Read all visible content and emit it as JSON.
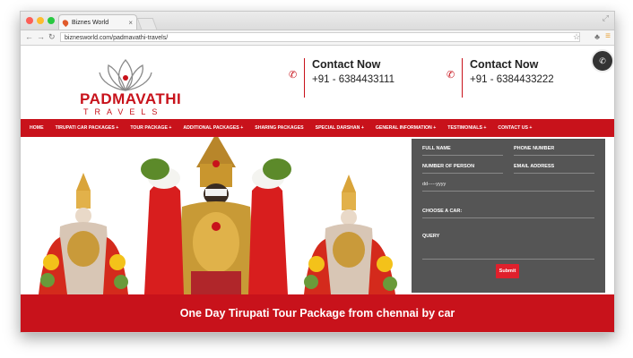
{
  "browser": {
    "tab_title": "Biznes World",
    "url": "biznesworld.com/padmavathi-travels/"
  },
  "logo": {
    "name": "PADMAVATHI",
    "sub": "TRAVELS"
  },
  "contacts": [
    {
      "title": "Contact Now",
      "number": "+91 - 6384433111"
    },
    {
      "title": "Contact Now",
      "number": "+91 - 6384433222"
    }
  ],
  "nav": [
    "HOME",
    "TIRUPATI CAR PACKAGES +",
    "TOUR PACKAGE +",
    "ADDITIONAL PACKAGES +",
    "SHARING PACKAGES",
    "SPECIAL DARSHAN +",
    "GENERAL INFORMATION +",
    "TESTIMONIALS +",
    "CONTACT US +"
  ],
  "form": {
    "full_name": "FULL NAME",
    "phone_number": "PHONE NUMBER",
    "number_of_person": "NUMBER OF PERSON",
    "email_address": "EMAIL ADDRESS",
    "date_placeholder": "dd-----yyyy",
    "choose_car": "CHOOSE A CAR:",
    "query": "QUERY",
    "submit": "Submit"
  },
  "banner": "One Day Tirupati Tour Package from chennai by car",
  "colors": {
    "brand_red": "#c8121b",
    "form_bg": "#555555"
  }
}
